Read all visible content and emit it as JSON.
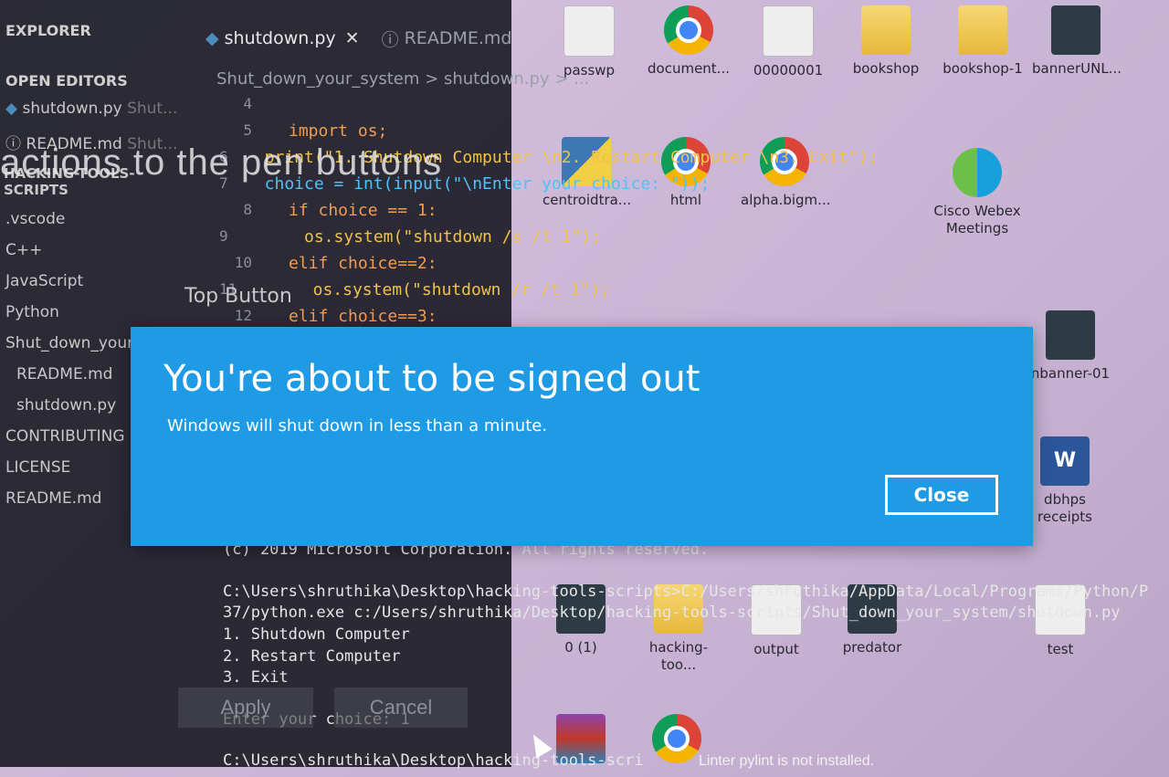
{
  "desktop": {
    "icons_row1": [
      "passwp",
      "document...",
      "00000001",
      "bookshop",
      "bookshop-1",
      "bannerUNL..."
    ],
    "icons_row2": [
      "centroidtra...",
      "html",
      "alpha.bigm...",
      "Cisco Webex Meetings"
    ],
    "icons_row3": [
      "nbanner-01",
      "dbhps receipts"
    ],
    "icons_row4": [
      "0 (1)",
      "hacking-too...",
      "output",
      "predator",
      "test"
    ]
  },
  "vscode": {
    "tabs": [
      {
        "label": "shutdown.py",
        "icon": "python-icon",
        "active": true
      },
      {
        "label": "README.md",
        "icon": "info-icon",
        "active": false
      }
    ],
    "explorer_header": "EXPLORER",
    "open_editors_header": "OPEN EDITORS",
    "open_editors": [
      {
        "label": "shutdown.py",
        "sub": "Shut..."
      },
      {
        "label": "README.md",
        "sub": "Shut..."
      }
    ],
    "project_header": "HACKING-TOOLS-SCRIPTS",
    "tree": [
      ".vscode",
      "C++",
      "JavaScript",
      "Python",
      "Shut_down_your_syst...",
      "README.md",
      "shutdown.py",
      "CONTRIBUTING",
      "LICENSE",
      "README.md"
    ],
    "breadcrumb": "Shut_down_your_system > shutdown.py > ...",
    "code": [
      {
        "n": "4",
        "text": ""
      },
      {
        "n": "5",
        "text": "import os;"
      },
      {
        "n": "6",
        "text": "print(\"1. Shutdown Computer \\n2. Restart Computer \\n3. Exit\");"
      },
      {
        "n": "7",
        "text": "choice = int(input(\"\\nEnter your choice: \"));"
      },
      {
        "n": "8",
        "text": "if choice == 1:"
      },
      {
        "n": "9",
        "text": "    os.system(\"shutdown /s /t 1\");"
      },
      {
        "n": "10",
        "text": "elif choice==2:"
      },
      {
        "n": "11",
        "text": "    os.system(\"shutdown /r /t 1\");"
      },
      {
        "n": "12",
        "text": "elif choice==3:"
      }
    ],
    "overlay_text": "actions to the pen buttons",
    "top_button_label": "Top Button",
    "apply_label": "Apply",
    "cancel_label": "Cancel"
  },
  "terminal": {
    "lines": [
      "(c) 2019 Microsoft Corporation. All rights reserved.",
      "",
      "C:\\Users\\shruthika\\Desktop\\hacking-tools-scripts>C:/Users/shruthika/AppData/Local/Programs/Python/P",
      "37/python.exe c:/Users/shruthika/Desktop/hacking-tools-scripts/Shut_down_your_system/shutdown.py",
      "1. Shutdown Computer",
      "2. Restart Computer",
      "3. Exit",
      "Enter your choice: 1",
      "",
      "C:\\Users\\shruthika\\Desktop\\hacking-tools-scri"
    ]
  },
  "status_message": "Linter pylint is not installed.",
  "dialog": {
    "title": "You're about to be signed out",
    "message": "Windows will shut down in less than a minute.",
    "close_label": "Close"
  }
}
